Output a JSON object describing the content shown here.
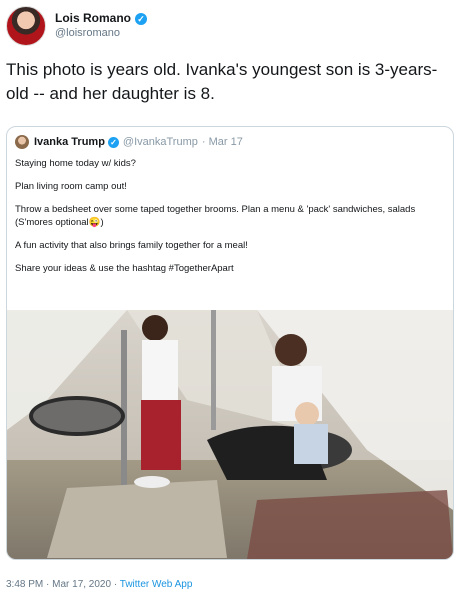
{
  "author": {
    "display_name": "Lois Romano",
    "handle": "@loisromano"
  },
  "tweet_text": "This photo is years old.  Ivanka's youngest son is 3-years-old -- and her daughter is 8.",
  "quoted": {
    "display_name": "Ivanka Trump",
    "handle": "@IvankaTrump",
    "date": "· Mar 17",
    "lines": [
      "Staying home today w/ kids?",
      "Plan living room camp out!",
      "Throw a bedsheet over some taped together brooms. Plan a menu & 'pack' sandwiches, salads (S'mores optional😜)",
      "A fun activity that also brings family together for a meal!",
      "Share your ideas & use the hashtag #TogetherApart"
    ]
  },
  "footer": {
    "timestamp": "3:48 PM · Mar 17, 2020 · ",
    "app": "Twitter Web App"
  },
  "icons": [
    "verified-badge-icon"
  ],
  "colors": {
    "accent": "#1da1f2",
    "link": "#1b95e0",
    "muted": "#657786"
  }
}
